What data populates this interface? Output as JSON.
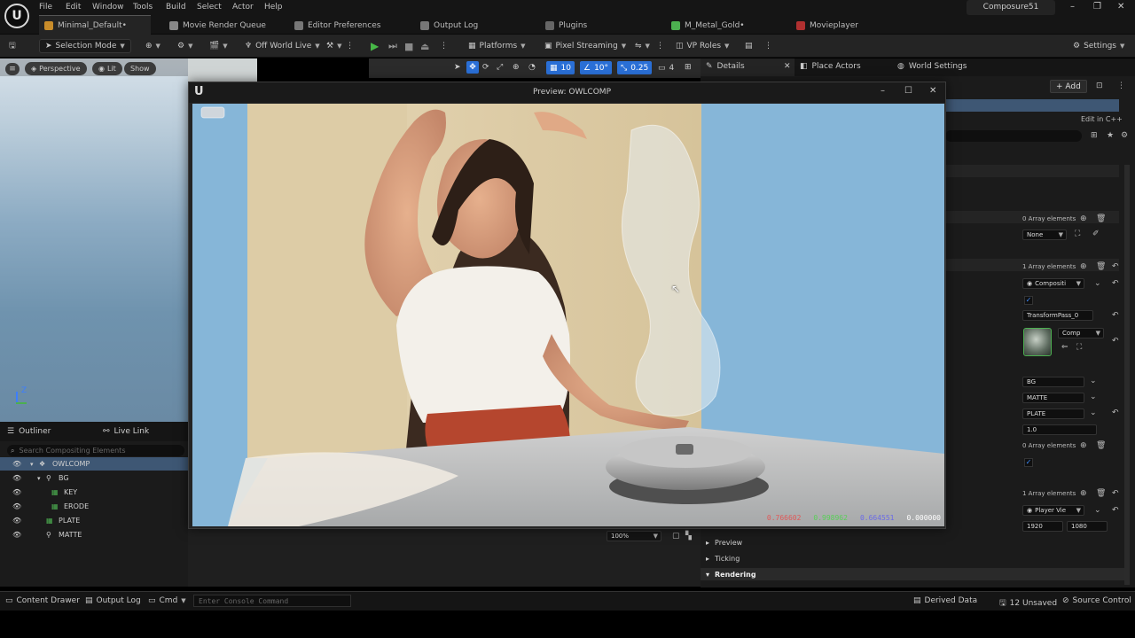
{
  "menu": {
    "items": [
      "File",
      "Edit",
      "Window",
      "Tools",
      "Build",
      "Select",
      "Actor",
      "Help"
    ],
    "project": "Composure51"
  },
  "tabs": [
    "Minimal_Default•",
    "Movie Render Queue",
    "Editor Preferences",
    "Output Log",
    "Plugins",
    "M_Metal_Gold•",
    "Movieplayer"
  ],
  "toolbar": {
    "selection_mode": "Selection Mode",
    "world": "Off World Live",
    "platforms": "Platforms",
    "pixel_streaming": "Pixel Streaming",
    "vp_roles": "VP Roles",
    "settings": "Settings",
    "grid": "10",
    "angle": "10°",
    "scale": "0.25",
    "cams": "4"
  },
  "viewport": {
    "perspective": "Perspective",
    "lit": "Lit",
    "show": "Show",
    "axis_z": "Z"
  },
  "details": {
    "tabs": [
      "Details",
      "Place Actors",
      "World Settings"
    ],
    "add": "+ Add",
    "edit_cpp": "Edit in C++",
    "array0": "0 Array elements",
    "none": "None",
    "array1": "1 Array elements",
    "composite": "Compositi",
    "transform_pass": "TransformPass_0",
    "comp": "Comp",
    "bg": "BG",
    "matte": "MATTE",
    "plate": "PLATE",
    "value_1": "1.0",
    "array0b": "0 Array elements",
    "array1b": "1 Array elements",
    "player_view": "Player Vie",
    "res_w": "1920",
    "res_h": "1080",
    "sections": [
      "Preview",
      "Ticking",
      "Rendering"
    ]
  },
  "outliner": {
    "title": "Outliner",
    "live_link": "Live Link",
    "search_placeholder": "Search Compositing Elements",
    "items": [
      "OWLCOMP",
      "BG",
      "KEY",
      "ERODE",
      "PLATE",
      "MATTE"
    ]
  },
  "preview": {
    "title": "Preview: OWLCOMP",
    "readout_r": "0.766602",
    "readout_g": "0.998962",
    "readout_b": "0.664551",
    "readout_a": "0.000000",
    "zoom": "100%"
  },
  "bottom": {
    "content_drawer": "Content Drawer",
    "output_log": "Output Log",
    "cmd": "Cmd",
    "console_placeholder": "Enter Console Command",
    "derived_data": "Derived Data",
    "unsaved": "12 Unsaved",
    "source_control": "Source Control"
  },
  "colors": {
    "accent": "#3d8cff",
    "play": "#47b847",
    "readout_r": "#e05858",
    "readout_g": "#58d058",
    "readout_b": "#6a6ae8"
  }
}
